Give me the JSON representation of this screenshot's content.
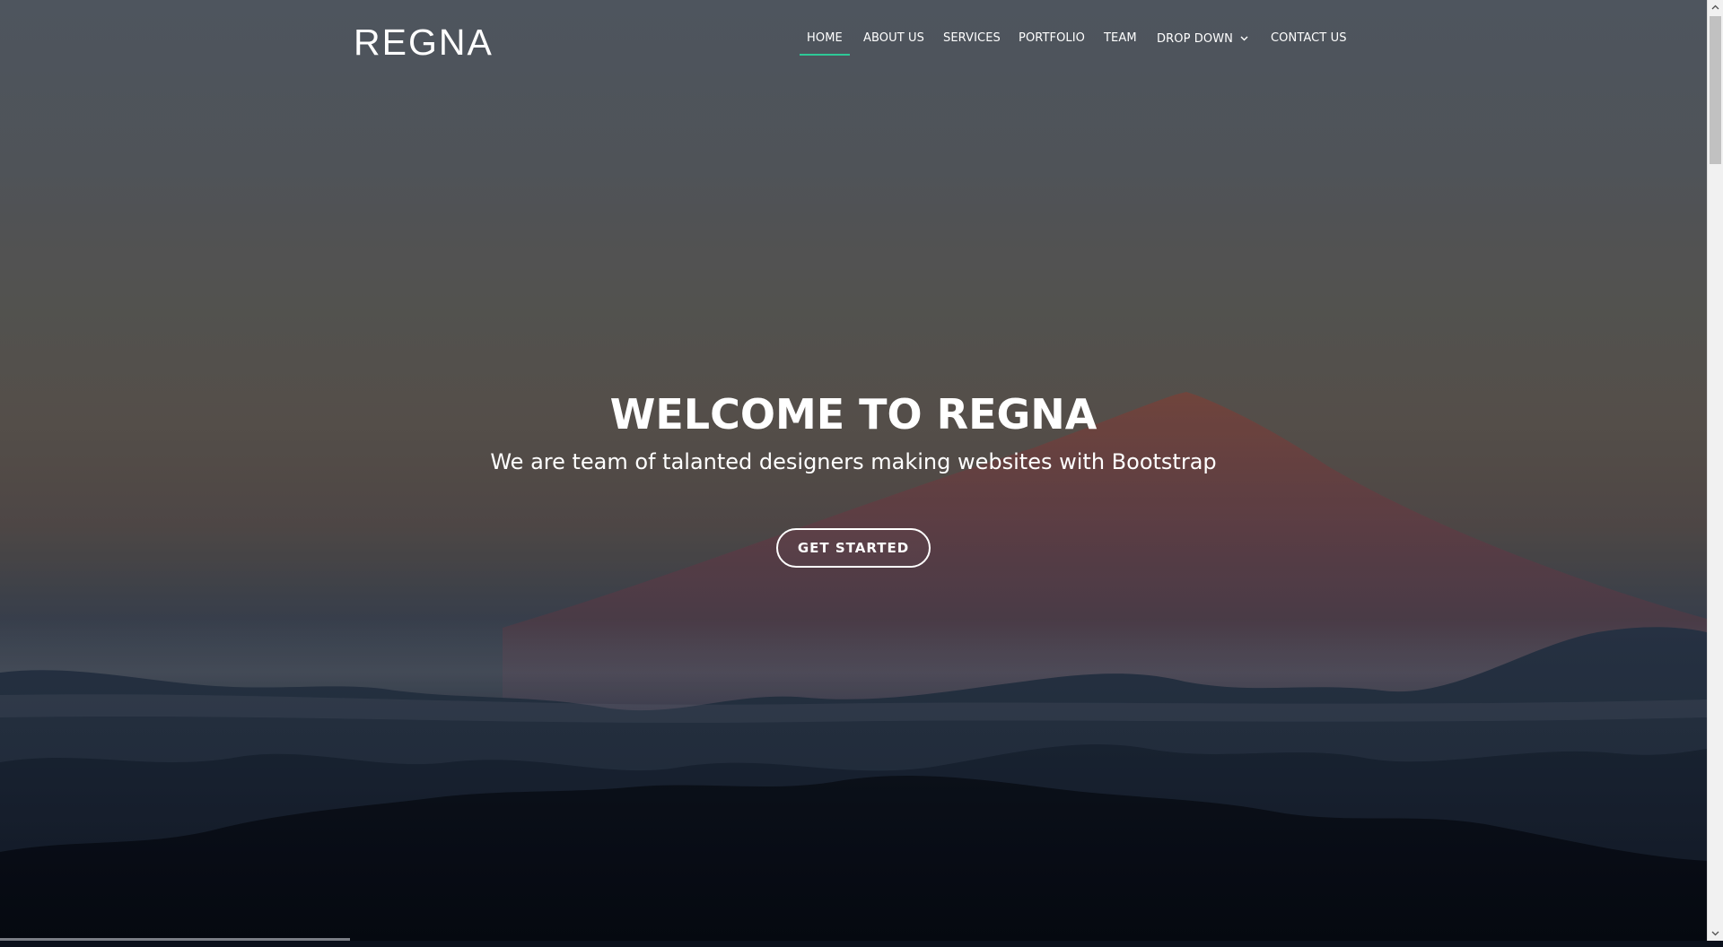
{
  "brand": {
    "logo_text": "REGNA",
    "accent_color": "#2dc997"
  },
  "nav": {
    "items": [
      {
        "label": "HOME",
        "active": true
      },
      {
        "label": "ABOUT US",
        "active": false
      },
      {
        "label": "SERVICES",
        "active": false
      },
      {
        "label": "PORTFOLIO",
        "active": false
      },
      {
        "label": "TEAM",
        "active": false
      },
      {
        "label": "DROP DOWN",
        "active": false,
        "icon": "chevron-down-icon"
      },
      {
        "label": "CONTACT US",
        "active": false
      }
    ]
  },
  "hero": {
    "title": "WELCOME TO REGNA",
    "subtitle": "We are team of talanted designers making websites with Bootstrap",
    "cta_label": "GET STARTED",
    "background": "mountain-at-dusk-photo"
  },
  "scrollbar": {
    "up_icon": "scroll-up-arrow-icon",
    "down_icon": "scroll-down-arrow-icon"
  }
}
